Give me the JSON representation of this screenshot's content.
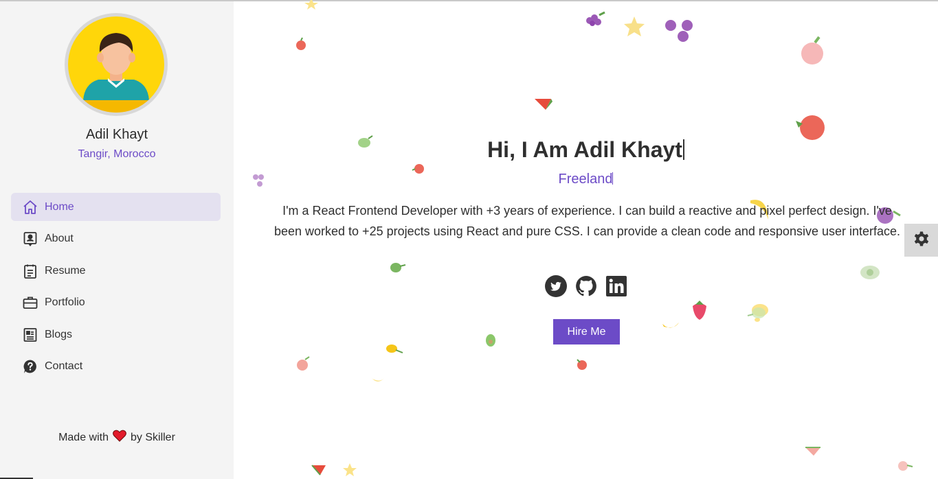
{
  "profile": {
    "name": "Adil Khayt",
    "location": "Tangir, Morocco"
  },
  "nav": {
    "items": [
      {
        "label": "Home",
        "icon": "home-icon",
        "active": true
      },
      {
        "label": "About",
        "icon": "user-card-icon",
        "active": false
      },
      {
        "label": "Resume",
        "icon": "clipboard-icon",
        "active": false
      },
      {
        "label": "Portfolio",
        "icon": "briefcase-icon",
        "active": false
      },
      {
        "label": "Blogs",
        "icon": "newspaper-icon",
        "active": false
      },
      {
        "label": "Contact",
        "icon": "help-circle-icon",
        "active": false
      }
    ]
  },
  "footer": {
    "made_with": "Made with",
    "by": "by Skiller"
  },
  "hero": {
    "title": "Hi, I Am Adil Khayt",
    "role": "Freeland",
    "description": "I'm a React Frontend Developer with +3 years of experience. I can build a reactive and pixel perfect design. I've been worked to +25 projects using React and pure CSS. I can provide a clean code and responsive user interface.",
    "hire_label": "Hire Me",
    "socials": [
      "twitter-icon",
      "github-icon",
      "linkedin-icon"
    ]
  },
  "colors": {
    "accent": "#6c4bc7",
    "sidebar_bg": "#f4f4f4",
    "active_nav_bg": "#e4e1f0",
    "avatar_bg": "#ffd60a",
    "heart": "#e21b2b"
  }
}
